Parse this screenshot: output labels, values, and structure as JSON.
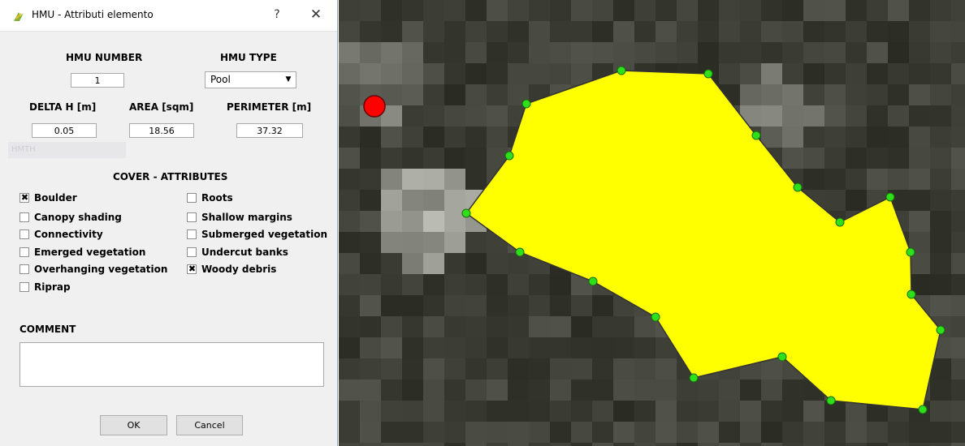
{
  "window": {
    "title": "HMU - Attributi elemento",
    "help_label": "?",
    "close_label": "✕"
  },
  "form": {
    "hmu_number": {
      "label": "HMU NUMBER",
      "value": "1"
    },
    "hmu_type": {
      "label": "HMU TYPE",
      "value": "Pool"
    },
    "delta_h": {
      "label": "DELTA H [m]",
      "value": "0.05"
    },
    "area": {
      "label": "AREA [sqm]",
      "value": "18.56"
    },
    "perimeter": {
      "label": "PERIMETER [m]",
      "value": "37.32"
    },
    "ghost_text": "HMTH"
  },
  "cover": {
    "title": "COVER - ATTRIBUTES",
    "items": [
      {
        "label": "Boulder",
        "checked": true
      },
      {
        "label": "Canopy shading",
        "checked": false
      },
      {
        "label": "Connectivity",
        "checked": false
      },
      {
        "label": "Emerged vegetation",
        "checked": false
      },
      {
        "label": "Overhanging vegetation",
        "checked": false
      },
      {
        "label": "Riprap",
        "checked": false
      },
      {
        "label": "Roots",
        "checked": false
      },
      {
        "label": "Shallow margins",
        "checked": false
      },
      {
        "label": "Submerged vegetation",
        "checked": false
      },
      {
        "label": "Undercut banks",
        "checked": false
      },
      {
        "label": "Woody debris",
        "checked": true
      }
    ]
  },
  "comment": {
    "label": "COMMENT",
    "value": ""
  },
  "buttons": {
    "ok": "OK",
    "cancel": "Cancel"
  },
  "colors": {
    "polygon_fill": "#ffff00",
    "vertex": "#2ee01a",
    "marker": "#ff0000"
  }
}
